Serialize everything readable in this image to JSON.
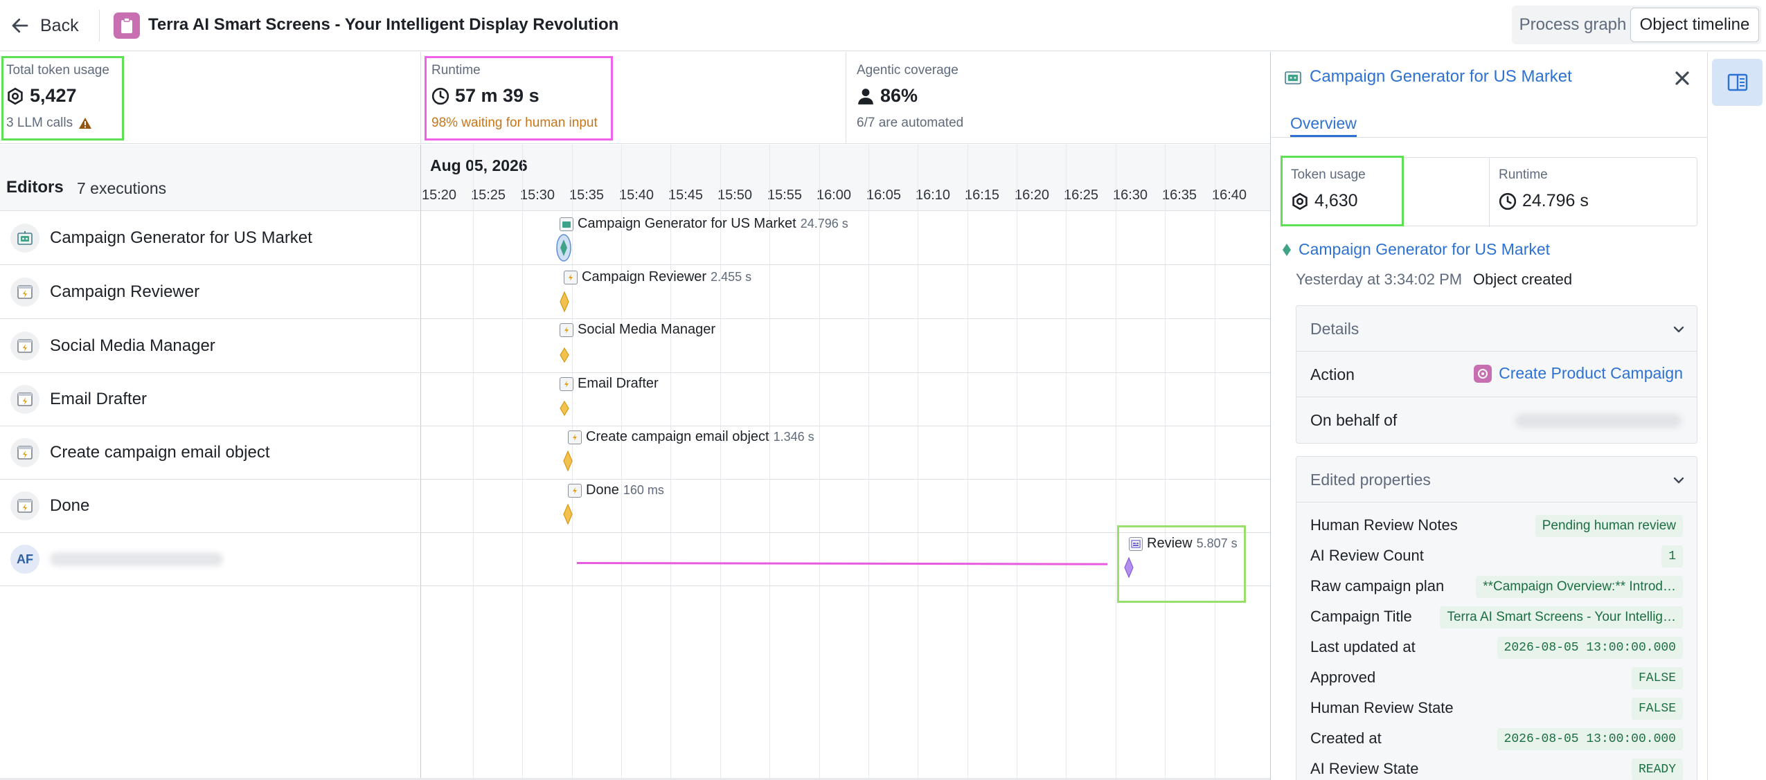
{
  "header": {
    "back_label": "Back",
    "title": "Terra AI Smart Screens - Your Intelligent Display Revolution",
    "view_options": [
      "Process graph",
      "Object timeline"
    ],
    "selected_view": "Object timeline"
  },
  "metrics": {
    "token": {
      "label": "Total token usage",
      "value": "5,427",
      "sub": "3 LLM calls"
    },
    "runtime": {
      "label": "Runtime",
      "value": "57 m 39 s",
      "sub": "98% waiting for human input"
    },
    "coverage": {
      "label": "Agentic coverage",
      "value": "86%",
      "sub": "6/7 are automated"
    }
  },
  "editors": {
    "title": "Editors",
    "count": "7 executions",
    "rows": [
      {
        "name": "Campaign Generator for US Market",
        "icon": "robot-icon"
      },
      {
        "name": "Campaign Reviewer",
        "icon": "function-icon"
      },
      {
        "name": "Social Media Manager",
        "icon": "function-icon"
      },
      {
        "name": "Email Drafter",
        "icon": "function-icon"
      },
      {
        "name": "Create campaign email object",
        "icon": "function-icon"
      },
      {
        "name": "Done",
        "icon": "function-icon"
      },
      {
        "name": "AF",
        "icon": "avatar"
      }
    ]
  },
  "timeline": {
    "date": "Aug 05, 2026",
    "ticks": [
      "15:20",
      "15:25",
      "15:30",
      "15:35",
      "15:40",
      "15:45",
      "15:50",
      "15:55",
      "16:00",
      "16:05",
      "16:10",
      "16:15",
      "16:20",
      "16:25",
      "16:30",
      "16:35",
      "16:40"
    ],
    "events": [
      {
        "name": "Campaign Generator for US Market",
        "duration": "24.796 s"
      },
      {
        "name": "Campaign Reviewer",
        "duration": "2.455 s"
      },
      {
        "name": "Social Media Manager",
        "duration": ""
      },
      {
        "name": "Email Drafter",
        "duration": ""
      },
      {
        "name": "Create campaign email object",
        "duration": "1.346 s"
      },
      {
        "name": "Done",
        "duration": "160 ms"
      },
      {
        "name": "Review",
        "duration": "5.807 s"
      }
    ]
  },
  "panel": {
    "title": "Campaign Generator for US Market",
    "tab": "Overview",
    "token_label": "Token usage",
    "token_value": "4,630",
    "runtime_label": "Runtime",
    "runtime_value": "24.796 s",
    "object_link": "Campaign Generator for US Market",
    "object_time": "Yesterday at 3:34:02 PM",
    "object_event": "Object created",
    "details": {
      "heading": "Details",
      "action_label": "Action",
      "action_value": "Create Product Campaign",
      "behalf_label": "On behalf of"
    },
    "edited": {
      "heading": "Edited properties",
      "props": [
        {
          "key": "Human Review Notes",
          "value": "Pending human review"
        },
        {
          "key": "AI Review Count",
          "value": "1"
        },
        {
          "key": "Raw campaign plan",
          "value": "**Campaign Overview:** Introd…"
        },
        {
          "key": "Campaign Title",
          "value": "Terra AI Smart Screens - Your Intellig…"
        },
        {
          "key": "Last updated at",
          "value": "2026-08-05 13:00:00.000"
        },
        {
          "key": "Approved",
          "value": "FALSE"
        },
        {
          "key": "Human Review State",
          "value": "FALSE"
        },
        {
          "key": "Created at",
          "value": "2026-08-05 13:00:00.000"
        },
        {
          "key": "AI Review State",
          "value": "READY"
        }
      ]
    }
  }
}
